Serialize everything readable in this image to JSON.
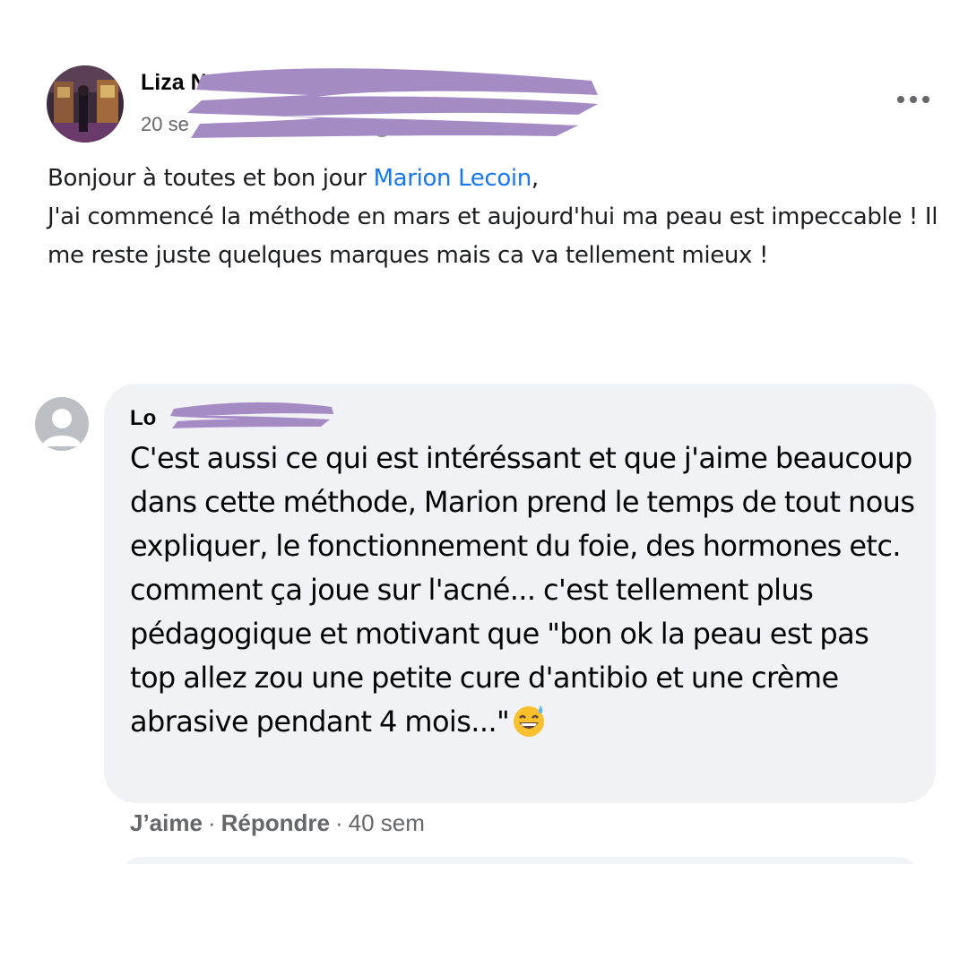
{
  "post": {
    "author": "Liza N",
    "date": "20 se",
    "more_icon": "more-horizontal-icon",
    "privacy_icon": "globe-icon",
    "body": {
      "greeting": "Bonjour à toutes et bon jour ",
      "mention": "Marion Lecoin",
      "greeting_end": ",",
      "line2": "J'ai commencé la méthode en mars et aujourd'hui ma peau est impeccable ! Il me reste juste quelques marques mais ca va tellement mieux !"
    }
  },
  "comment": {
    "author": "Lo",
    "text": "C'est aussi ce qui est intéréssant et que j'aime beaucoup dans cette méthode, Marion prend le temps de tout nous expliquer, le fonctionnement du foie, des hormones etc. comment ça joue sur l'acné... c'est tellement plus pédagogique et motivant que \"bon ok la peau est pas top allez zou une petite cure d'antibio et une crème abrasive pendant 4 mois...\"",
    "emoji": "grinning-sweat-emoji",
    "actions": {
      "like": "J’aime",
      "separator": "·",
      "reply": "Répondre",
      "time": "40 sem"
    }
  },
  "colors": {
    "mention": "#1877f2",
    "bubble": "#f0f2f5",
    "meta_text": "#65676b",
    "redaction": "#a58bc4"
  }
}
